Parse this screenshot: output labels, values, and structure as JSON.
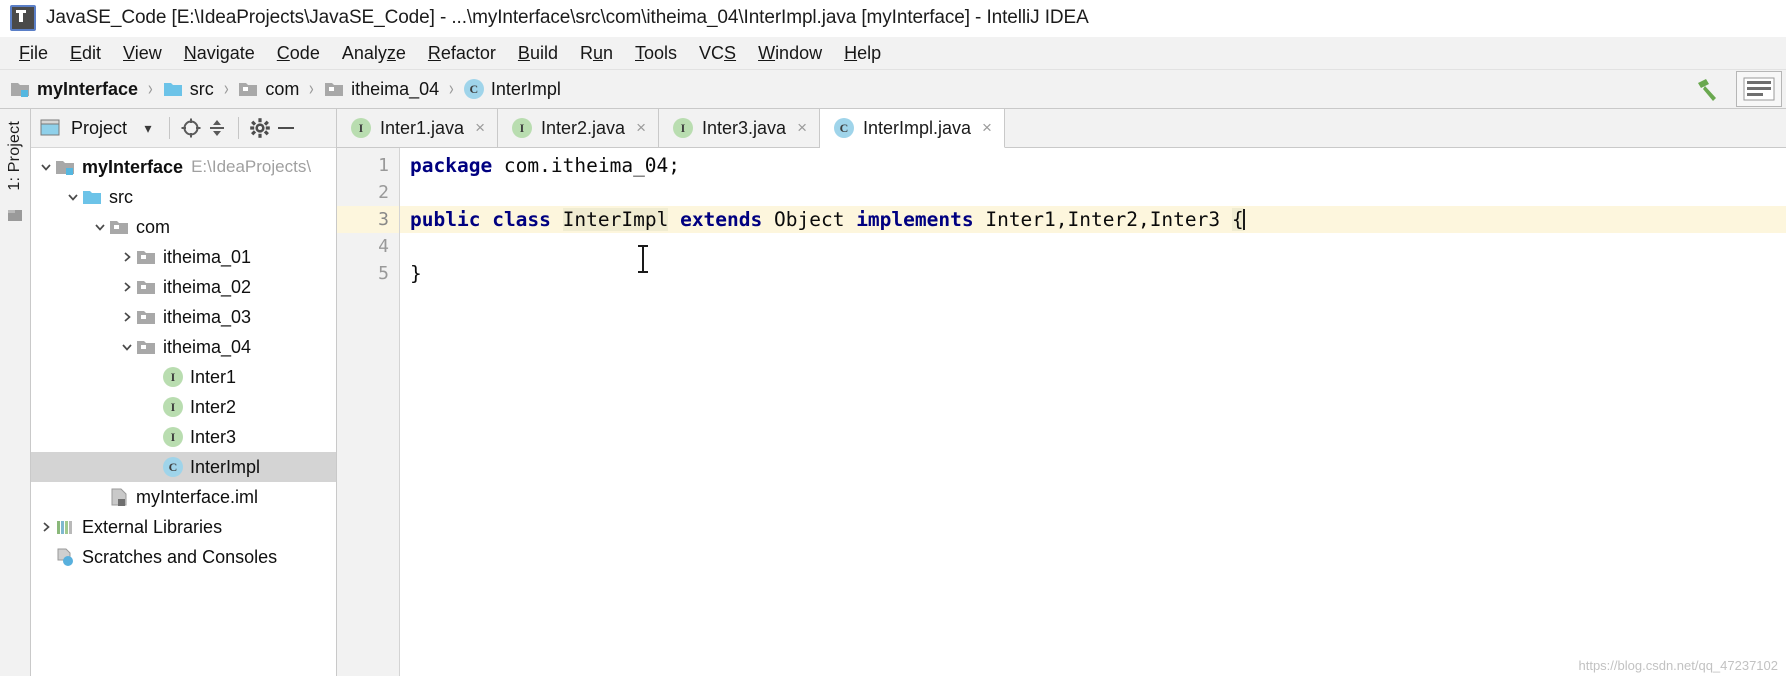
{
  "window": {
    "title": "JavaSE_Code [E:\\IdeaProjects\\JavaSE_Code] - ...\\myInterface\\src\\com\\itheima_04\\InterImpl.java [myInterface] - IntelliJ IDEA",
    "app_icon": "intellij-idea-icon"
  },
  "menubar": {
    "items": [
      {
        "label": "File",
        "mnemonic": "F"
      },
      {
        "label": "Edit",
        "mnemonic": "E"
      },
      {
        "label": "View",
        "mnemonic": "V"
      },
      {
        "label": "Navigate",
        "mnemonic": "N"
      },
      {
        "label": "Code",
        "mnemonic": "C"
      },
      {
        "label": "Analyze",
        "mnemonic": "z"
      },
      {
        "label": "Refactor",
        "mnemonic": "R"
      },
      {
        "label": "Build",
        "mnemonic": "B"
      },
      {
        "label": "Run",
        "mnemonic": "u"
      },
      {
        "label": "Tools",
        "mnemonic": "T"
      },
      {
        "label": "VCS",
        "mnemonic": "S"
      },
      {
        "label": "Window",
        "mnemonic": "W"
      },
      {
        "label": "Help",
        "mnemonic": "H"
      }
    ]
  },
  "navbar": {
    "crumbs": [
      {
        "label": "myInterface",
        "icon": "module-icon"
      },
      {
        "label": "src",
        "icon": "source-folder-icon"
      },
      {
        "label": "com",
        "icon": "package-folder-icon"
      },
      {
        "label": "itheima_04",
        "icon": "package-folder-icon"
      },
      {
        "label": "InterImpl",
        "icon": "class-icon"
      }
    ],
    "separator": "›",
    "actions": [
      {
        "name": "build-hammer-icon",
        "label": "Build"
      },
      {
        "name": "layout-settings-icon",
        "label": ""
      }
    ]
  },
  "left_strip": {
    "tabs": [
      {
        "label": "1: Project"
      }
    ],
    "icons": [
      "structure-icon"
    ]
  },
  "tool_window": {
    "title": "Project",
    "dropdown_glyph": "▾",
    "buttons": [
      {
        "name": "locate-target-icon"
      },
      {
        "name": "collapse-all-icon"
      },
      {
        "name": "settings-gear-icon"
      },
      {
        "name": "hide-window-icon"
      }
    ],
    "tree": [
      {
        "depth": 0,
        "arrow": "expanded",
        "icon": "module-icon",
        "label": "myInterface",
        "bold": true,
        "hint": "E:\\IdeaProjects\\",
        "selected": false
      },
      {
        "depth": 1,
        "arrow": "expanded",
        "icon": "source-folder-icon",
        "label": "src",
        "bold": false,
        "hint": "",
        "selected": false
      },
      {
        "depth": 2,
        "arrow": "expanded",
        "icon": "package-folder-icon",
        "label": "com",
        "bold": false,
        "hint": "",
        "selected": false
      },
      {
        "depth": 3,
        "arrow": "collapsed",
        "icon": "package-folder-icon",
        "label": "itheima_01",
        "bold": false,
        "hint": "",
        "selected": false
      },
      {
        "depth": 3,
        "arrow": "collapsed",
        "icon": "package-folder-icon",
        "label": "itheima_02",
        "bold": false,
        "hint": "",
        "selected": false
      },
      {
        "depth": 3,
        "arrow": "collapsed",
        "icon": "package-folder-icon",
        "label": "itheima_03",
        "bold": false,
        "hint": "",
        "selected": false
      },
      {
        "depth": 3,
        "arrow": "expanded",
        "icon": "package-folder-icon",
        "label": "itheima_04",
        "bold": false,
        "hint": "",
        "selected": false
      },
      {
        "depth": 4,
        "arrow": "none",
        "icon": "interface-icon",
        "label": "Inter1",
        "bold": false,
        "hint": "",
        "selected": false
      },
      {
        "depth": 4,
        "arrow": "none",
        "icon": "interface-icon",
        "label": "Inter2",
        "bold": false,
        "hint": "",
        "selected": false
      },
      {
        "depth": 4,
        "arrow": "none",
        "icon": "interface-icon",
        "label": "Inter3",
        "bold": false,
        "hint": "",
        "selected": false
      },
      {
        "depth": 4,
        "arrow": "none",
        "icon": "class-icon",
        "label": "InterImpl",
        "bold": false,
        "hint": "",
        "selected": true
      },
      {
        "depth": 2,
        "arrow": "none",
        "icon": "iml-file-icon",
        "label": "myInterface.iml",
        "bold": false,
        "hint": "",
        "selected": false
      },
      {
        "depth": 0,
        "arrow": "collapsed",
        "icon": "external-libraries-icon",
        "label": "External Libraries",
        "bold": false,
        "hint": "",
        "selected": false
      },
      {
        "depth": 0,
        "arrow": "none",
        "icon": "scratches-icon",
        "label": "Scratches and Consoles",
        "bold": false,
        "hint": "",
        "selected": false
      }
    ]
  },
  "editor": {
    "tabs": [
      {
        "label": "Inter1.java",
        "icon": "interface-icon",
        "active": false,
        "close": "×"
      },
      {
        "label": "Inter2.java",
        "icon": "interface-icon",
        "active": false,
        "close": "×"
      },
      {
        "label": "Inter3.java",
        "icon": "interface-icon",
        "active": false,
        "close": "×"
      },
      {
        "label": "InterImpl.java",
        "icon": "class-icon",
        "active": true,
        "close": "×"
      }
    ],
    "line_numbers": [
      "1",
      "2",
      "3",
      "4",
      "5"
    ],
    "current_line": 3,
    "lines": [
      {
        "n": "1",
        "tokens": [
          {
            "t": "package",
            "c": "kw"
          },
          {
            "t": " com.itheima_04;",
            "c": "plain"
          }
        ]
      },
      {
        "n": "2",
        "tokens": []
      },
      {
        "n": "3",
        "tokens": [
          {
            "t": "public",
            "c": "kw"
          },
          {
            "t": " ",
            "c": "plain"
          },
          {
            "t": "class",
            "c": "kw"
          },
          {
            "t": " ",
            "c": "plain"
          },
          {
            "t": "InterImpl",
            "c": "ident-hl"
          },
          {
            "t": " ",
            "c": "plain"
          },
          {
            "t": "extends",
            "c": "kw"
          },
          {
            "t": " Object ",
            "c": "plain"
          },
          {
            "t": "implements",
            "c": "kw"
          },
          {
            "t": " Inter1,Inter2,Inter3 ",
            "c": "plain"
          },
          {
            "t": "{",
            "c": "ident-hl"
          }
        ]
      },
      {
        "n": "4",
        "tokens": []
      },
      {
        "n": "5",
        "tokens": [
          {
            "t": "}",
            "c": "plain"
          }
        ]
      }
    ],
    "caret_line": 3,
    "text_cursor": "i-beam-cursor"
  },
  "watermark": {
    "text": "https://blog.csdn.net/qq_47237102"
  },
  "colors": {
    "keyword": "#000080",
    "current_line_bg": "#fdf6dd",
    "selection_bg": "#d4d4d4",
    "interface_icon": "#b9ddb0",
    "class_icon": "#9fd4ea",
    "chrome_bg": "#f2f2f2"
  }
}
